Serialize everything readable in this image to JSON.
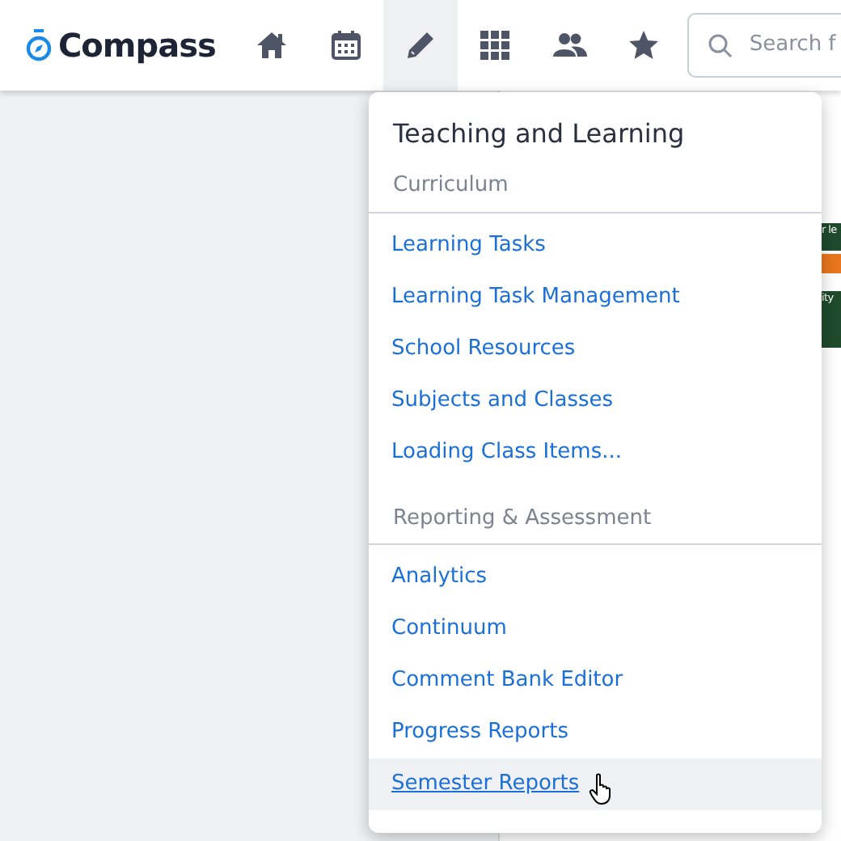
{
  "brand": {
    "name": "Compass"
  },
  "nav_icons": [
    {
      "kind": "home",
      "selected": false
    },
    {
      "kind": "calendar",
      "selected": false
    },
    {
      "kind": "pencil",
      "selected": true
    },
    {
      "kind": "grid",
      "selected": false
    },
    {
      "kind": "people",
      "selected": false
    },
    {
      "kind": "star",
      "selected": false
    }
  ],
  "search": {
    "placeholder": "Search f"
  },
  "calendar_events": [
    {
      "text": "r le",
      "color": "#1f4a2c"
    },
    {
      "color": "#e8761e"
    },
    {
      "text": "ity",
      "color": "#1f4a2c"
    }
  ],
  "menu": {
    "title": "Teaching and Learning",
    "sections": [
      {
        "heading": "Curriculum",
        "items": [
          {
            "label": "Learning Tasks",
            "hovered": false
          },
          {
            "label": "Learning Task Management",
            "hovered": false
          },
          {
            "label": "School Resources",
            "hovered": false
          },
          {
            "label": "Subjects and Classes",
            "hovered": false
          },
          {
            "label": "Loading Class Items...",
            "hovered": false
          }
        ]
      },
      {
        "heading": "Reporting & Assessment",
        "items": [
          {
            "label": "Analytics",
            "hovered": false
          },
          {
            "label": "Continuum",
            "hovered": false
          },
          {
            "label": "Comment Bank Editor",
            "hovered": false
          },
          {
            "label": "Progress Reports",
            "hovered": false
          },
          {
            "label": "Semester Reports",
            "hovered": true
          }
        ]
      }
    ]
  }
}
